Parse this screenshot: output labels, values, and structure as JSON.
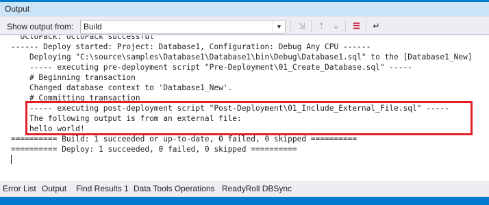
{
  "window": {
    "title": "Output"
  },
  "toolbar": {
    "show_output_label": "Show output from:",
    "source_selected": "Build",
    "icons": [
      "find-message-icon",
      "go-to-previous-icon",
      "go-to-next-icon",
      "clear-all-icon",
      "word-wrap-icon"
    ]
  },
  "output": {
    "lines": [
      "  OctoPack: OctoPack successful",
      "------ Deploy started: Project: Database1, Configuration: Debug Any CPU ------",
      "    Deploying \"C:\\source\\samples\\Database1\\Database1\\bin\\Debug\\Database1.sql\" to the [Database1_New]",
      "    ----- executing pre-deployment script \"Pre-Deployment\\01_Create_Database.sql\" -----",
      "    # Beginning transaction",
      "    Changed database context to 'Database1_New'.",
      "    # Committing transaction",
      "    ----- executing post-deployment script \"Post-Deployment\\01_Include_External_File.sql\" -----",
      "    The following output is from an external file:",
      "    hello world!",
      "========== Build: 1 succeeded or up-to-date, 0 failed, 0 skipped ==========",
      "========== Deploy: 1 succeeded, 0 failed, 0 skipped =========="
    ]
  },
  "tabs": [
    "Error List",
    "Output",
    "Find Results 1",
    "Data Tools Operations",
    "ReadyRoll DBSync"
  ],
  "colors": {
    "accent": "#007acc",
    "highlight": "#e31e26"
  }
}
